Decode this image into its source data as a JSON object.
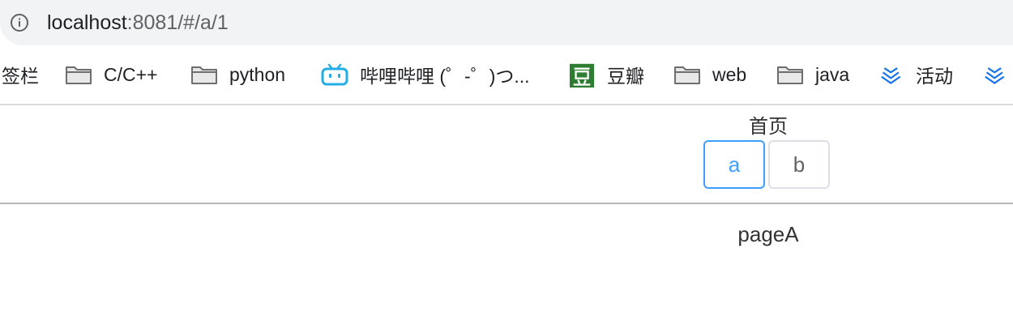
{
  "browser": {
    "url_host": "localhost",
    "url_path": ":8081/#/a/1",
    "bookmarks": [
      {
        "label": "签栏",
        "icon": "none"
      },
      {
        "label": "C/C++",
        "icon": "folder-icon"
      },
      {
        "label": "python",
        "icon": "folder-icon"
      },
      {
        "label": "哔哩哔哩 (゜-゜)つ...",
        "icon": "bilibili-icon"
      },
      {
        "label": "豆瓣",
        "icon": "douban-icon"
      },
      {
        "label": "web",
        "icon": "folder-icon"
      },
      {
        "label": "java",
        "icon": "folder-icon"
      },
      {
        "label": "活动",
        "icon": "chevron-stack-icon"
      }
    ]
  },
  "app": {
    "title": "首页",
    "tabs": [
      {
        "label": "a",
        "active": true
      },
      {
        "label": "b",
        "active": false
      }
    ],
    "content": "pageA",
    "accent_color": "#409eff"
  }
}
